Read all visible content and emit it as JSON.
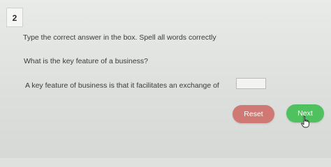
{
  "question": {
    "number": "2",
    "instructions": "Type the correct answer in the box. Spell all words correctly",
    "prompt": "What is the key feature of a business?",
    "statement": "A key feature of business is that it facilitates an exchange of",
    "answer": {
      "value": "",
      "placeholder": ""
    }
  },
  "buttons": {
    "reset_label": "Reset",
    "next_label": "Next"
  },
  "colors": {
    "reset": "#d07873",
    "next": "#4fc25f",
    "background": "#dfe1de"
  },
  "icons": {
    "pointer": "hand-pointer-icon"
  }
}
